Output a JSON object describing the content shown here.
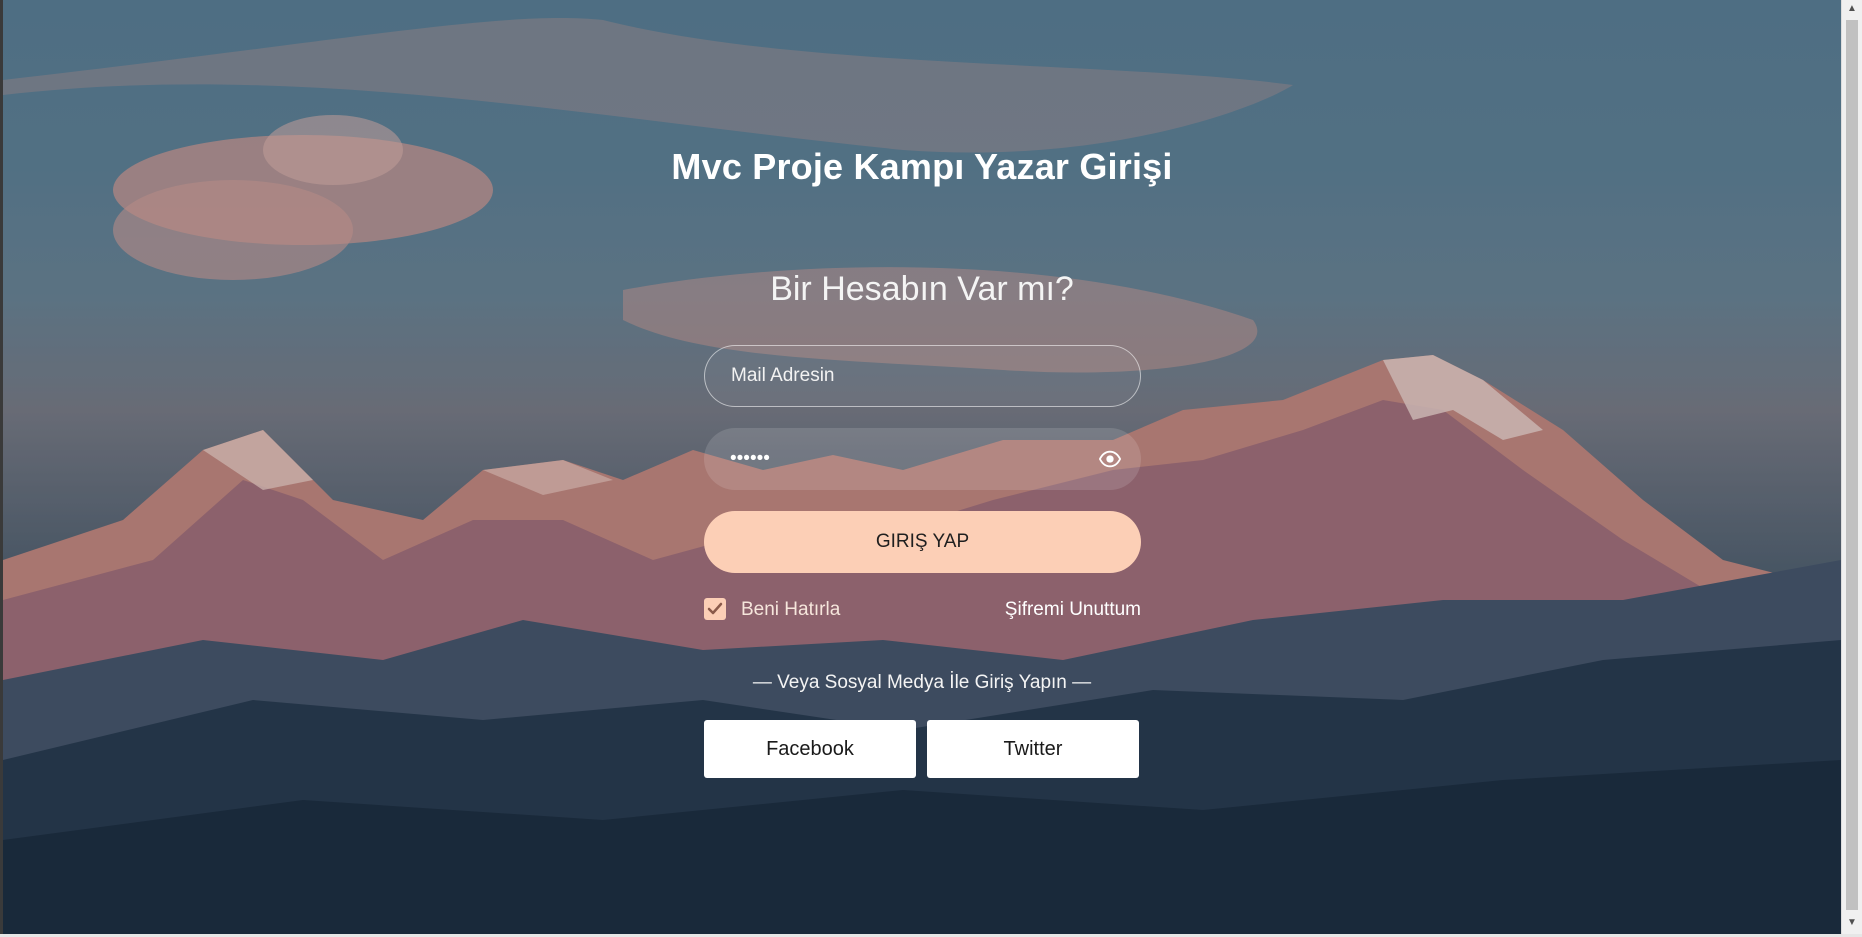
{
  "page": {
    "title": "Mvc Proje Kampı Yazar Girişi",
    "subtitle": "Bir Hesabın Var mı?"
  },
  "form": {
    "email_placeholder": "Mail Adresin",
    "password_value": "******",
    "login_label": "GIRIŞ YAP",
    "remember_label": "Beni Hatırla",
    "remember_checked": true,
    "forgot_label": "Şifremi Unuttum"
  },
  "social": {
    "divider_text": "— Veya Sosyal Medya İle Giriş Yapın —",
    "facebook_label": "Facebook",
    "twitter_label": "Twitter"
  },
  "colors": {
    "accent": "#fccfb6",
    "button_text": "#1f1f1f",
    "social_button_bg": "#ffffff"
  },
  "icons": {
    "password_toggle": "eye-icon",
    "remember": "check-icon"
  }
}
